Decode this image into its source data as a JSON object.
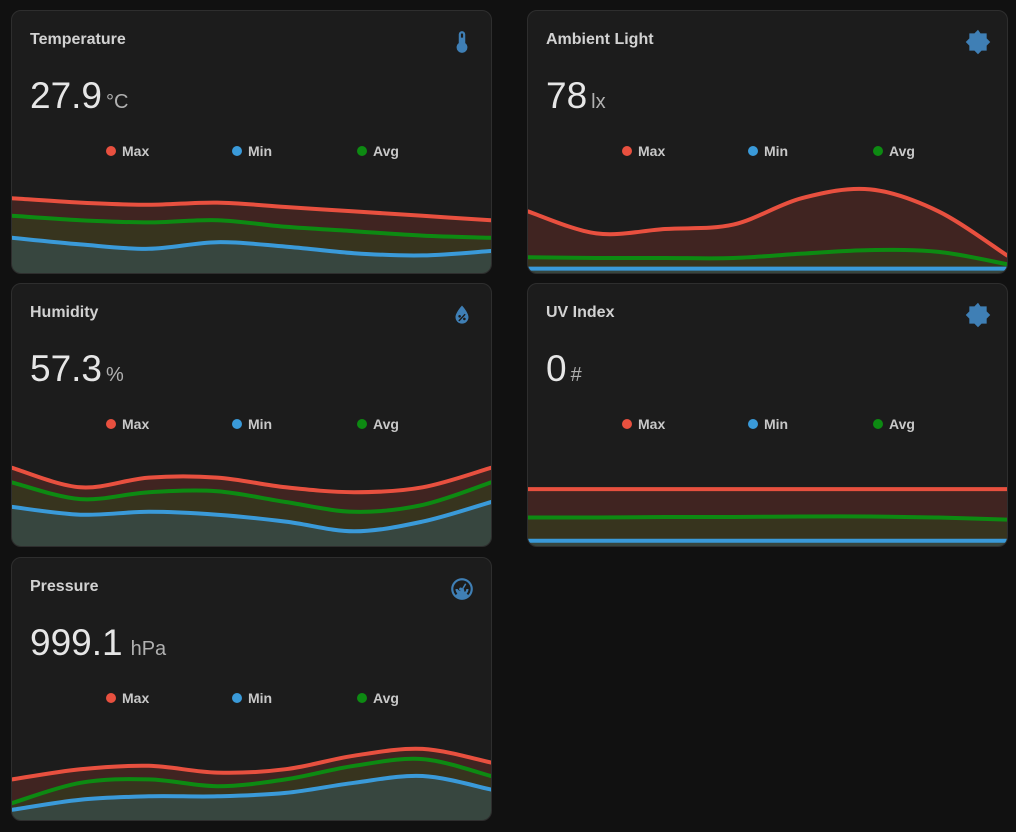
{
  "colors": {
    "max": "#e8503f",
    "min": "#3a9ad9",
    "avg": "#0d8a12",
    "icon": "#3f7fb5"
  },
  "legend": {
    "max": "Max",
    "min": "Min",
    "avg": "Avg"
  },
  "cards": [
    {
      "id": "temperature",
      "title": "Temperature",
      "value": "27.9",
      "unit": "°C",
      "icon": "thermometer-icon",
      "chart_data": {
        "type": "area",
        "series": [
          {
            "name": "Max",
            "values": [
              27.4,
              27.2,
              27.1,
              27.2,
              27.0,
              26.8,
              26.6,
              26.4
            ]
          },
          {
            "name": "Min",
            "values": [
              25.6,
              25.3,
              25.1,
              25.4,
              25.2,
              24.9,
              24.8,
              25.0
            ]
          },
          {
            "name": "Avg",
            "values": [
              26.6,
              26.4,
              26.3,
              26.4,
              26.1,
              25.9,
              25.7,
              25.6
            ]
          }
        ],
        "ylim": [
          24.0,
          28.0
        ]
      }
    },
    {
      "id": "ambient-light",
      "title": "Ambient Light",
      "value": "78",
      "unit": "lx",
      "icon": "sun-icon",
      "chart_data": {
        "type": "area",
        "series": [
          {
            "name": "Max",
            "values": [
              70,
              45,
              50,
              55,
              85,
              95,
              70,
              20
            ]
          },
          {
            "name": "Min",
            "values": [
              5,
              5,
              5,
              5,
              5,
              5,
              5,
              5
            ]
          },
          {
            "name": "Avg",
            "values": [
              18,
              17,
              17,
              17,
              22,
              26,
              24,
              10
            ]
          }
        ],
        "ylim": [
          0,
          100
        ]
      }
    },
    {
      "id": "humidity",
      "title": "Humidity",
      "value": "57.3",
      "unit": "%",
      "icon": "water-percent-icon",
      "chart_data": {
        "type": "area",
        "series": [
          {
            "name": "Max",
            "values": [
              60,
              58,
              59,
              59,
              58,
              57.5,
              58,
              60
            ]
          },
          {
            "name": "Min",
            "values": [
              56,
              55.2,
              55.5,
              55.2,
              54.5,
              53.5,
              54.5,
              56.5
            ]
          },
          {
            "name": "Avg",
            "values": [
              58.5,
              56.8,
              57.5,
              57.6,
              56.5,
              55.5,
              56.2,
              58.5
            ]
          }
        ],
        "ylim": [
          52,
          61
        ]
      }
    },
    {
      "id": "uv-index",
      "title": "UV Index",
      "value": "0",
      "unit": "#",
      "icon": "sun-icon",
      "chart_data": {
        "type": "area",
        "series": [
          {
            "name": "Max",
            "values": [
              1,
              1,
              1,
              1,
              1,
              1,
              1,
              1
            ]
          },
          {
            "name": "Min",
            "values": [
              0,
              0,
              0,
              0,
              0,
              0,
              0,
              0
            ]
          },
          {
            "name": "Avg",
            "values": [
              0.45,
              0.45,
              0.46,
              0.46,
              0.47,
              0.47,
              0.45,
              0.41
            ]
          }
        ],
        "ylim": [
          -0.1,
          1.6
        ]
      }
    },
    {
      "id": "pressure",
      "title": "Pressure",
      "value": "999.1",
      "unit": "hPa",
      "icon": "gauge-icon",
      "chart_data": {
        "type": "area",
        "series": [
          {
            "name": "Max",
            "values": [
              998.2,
              998.5,
              998.6,
              998.4,
              998.5,
              998.9,
              999.1,
              998.7
            ]
          },
          {
            "name": "Min",
            "values": [
              997.3,
              997.6,
              997.7,
              997.7,
              997.8,
              998.1,
              998.3,
              997.9
            ]
          },
          {
            "name": "Avg",
            "values": [
              997.5,
              998.1,
              998.2,
              998.0,
              998.2,
              998.6,
              998.8,
              998.3
            ]
          }
        ],
        "ylim": [
          997.0,
          999.6
        ]
      }
    }
  ]
}
